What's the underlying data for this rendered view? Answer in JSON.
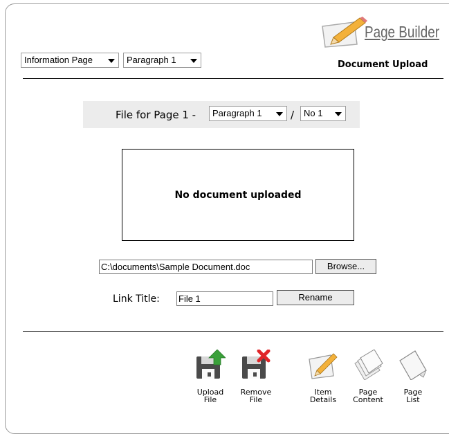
{
  "header": {
    "brand": "Page Builder",
    "section_title": "Document Upload",
    "page_type_select": "Information Page",
    "paragraph_select": "Paragraph 1"
  },
  "file_section": {
    "label": "File for Page 1 -",
    "paragraph_select": "Paragraph 1",
    "separator": "/",
    "number_select": "No 1"
  },
  "document_box": {
    "message": "No document uploaded"
  },
  "upload": {
    "path_value": "C:\\documents\\Sample Document.doc",
    "browse_label": "Browse..."
  },
  "link": {
    "label": "Link Title:",
    "title_value": "File 1",
    "rename_label": "Rename"
  },
  "toolbar": {
    "upload_label": "Upload\nFile",
    "remove_label": "Remove\nFile",
    "item_details_label": "Item\nDetails",
    "page_content_label": "Page\nContent",
    "page_list_label": "Page\nList"
  },
  "icons": {
    "logo": "pencil-paper-icon",
    "upload": "floppy-upload-icon",
    "remove": "floppy-remove-icon",
    "item_details": "pencil-paper-icon",
    "page_content": "page-stack-icon",
    "page_list": "page-icon"
  },
  "colors": {
    "upload_arrow": "#3aa03a",
    "remove_x": "#e0262a",
    "file_bar_bg": "#ececec"
  }
}
